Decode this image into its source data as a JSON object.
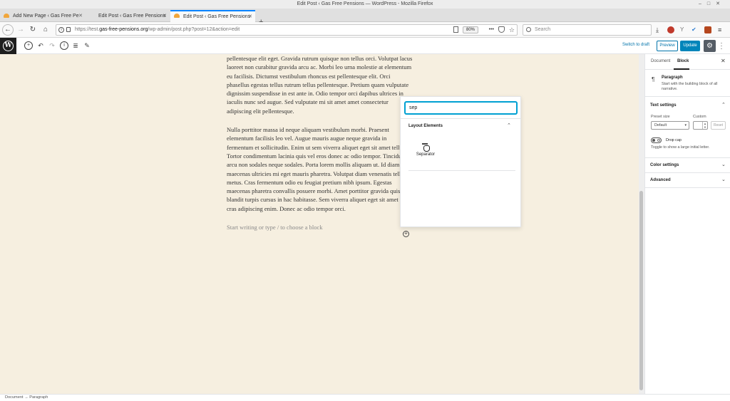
{
  "window": {
    "title": "Edit Post ‹ Gas Free Pensions — WordPress - Mozilla Firefox"
  },
  "tabs": [
    {
      "label": "Add New Page ‹ Gas Free Pe"
    },
    {
      "label": "Edit Post ‹ Gas Free Pensions"
    },
    {
      "label": "Edit Post ‹ Gas Free Pensions"
    }
  ],
  "nav": {
    "url_prefix": "https://test.",
    "url_domain": "gas-free-pensions.org",
    "url_suffix": "/wp-admin/post.php?post=12&action=edit",
    "zoom": "80%",
    "search_placeholder": "Search"
  },
  "toolbar": {
    "switch_to_draft": "Switch to draft",
    "preview": "Preview",
    "update": "Update"
  },
  "content": {
    "paragraph1": "pellentesque elit eget. Gravida rutrum quisque non tellus orci. Volutpat lacus laoreet non curabitur gravida arcu ac. Morbi leo urna molestie at elementum eu facilisis. Dictumst vestibulum rhoncus est pellentesque elit. Orci phasellus egestas tellus rutrum tellus pellentesque. Pretium quam vulputate dignissim suspendisse in est ante in. Odio tempor orci dapibus ultrices in iaculis nunc sed augue. Sed vulputate mi sit amet amet consectetur adipiscing elit pellentesque.",
    "paragraph2": "Nulla porttitor massa id neque aliquam vestibulum morbi. Praesent elementum facilisis leo vel. Augue mauris augue neque gravida in fermentum et sollicitudin. Enim ut sem viverra aliquet eget sit amet tellus. Tortor condimentum lacinia quis vel eros donec ac odio tempor. Tincidunt arcu non sodales neque sodales. Porta lorem mollis aliquam ut. Id diam maecenas ultricies mi eget mauris pharetra. Volutpat diam venenatis tellus in metus. Cras fermentum odio eu feugiat pretium nibh ipsum. Egestas maecenas pharetra convallis posuere morbi. Amet porttitor gravida quis blandit turpis cursus in hac habitasse. Sem viverra aliquet eget sit amet tellus cras adipiscing enim. Donec ac odio tempor orci.",
    "placeholder": "Start writing or type / to choose a block"
  },
  "inserter": {
    "search_value": "sep",
    "panel_title": "Layout Elements",
    "item_label": "Separator"
  },
  "sidebar": {
    "tab_document": "Document",
    "tab_block": "Block",
    "block_name": "Paragraph",
    "block_desc": "Start with the building block of all narrative.",
    "text_settings": "Text settings",
    "preset_size_label": "Preset size",
    "custom_label": "Custom",
    "preset_value": "Default",
    "reset": "Reset",
    "drop_cap": "Drop cap",
    "drop_cap_help": "Toggle to show a large initial letter.",
    "color_settings": "Color settings",
    "advanced": "Advanced"
  },
  "breadcrumb": {
    "document": "Document",
    "arrow": "→",
    "paragraph": "Paragraph"
  },
  "colors": {
    "accent": "#0085ba",
    "editor_bg": "#f6efe0",
    "focus": "#00a0d2"
  }
}
